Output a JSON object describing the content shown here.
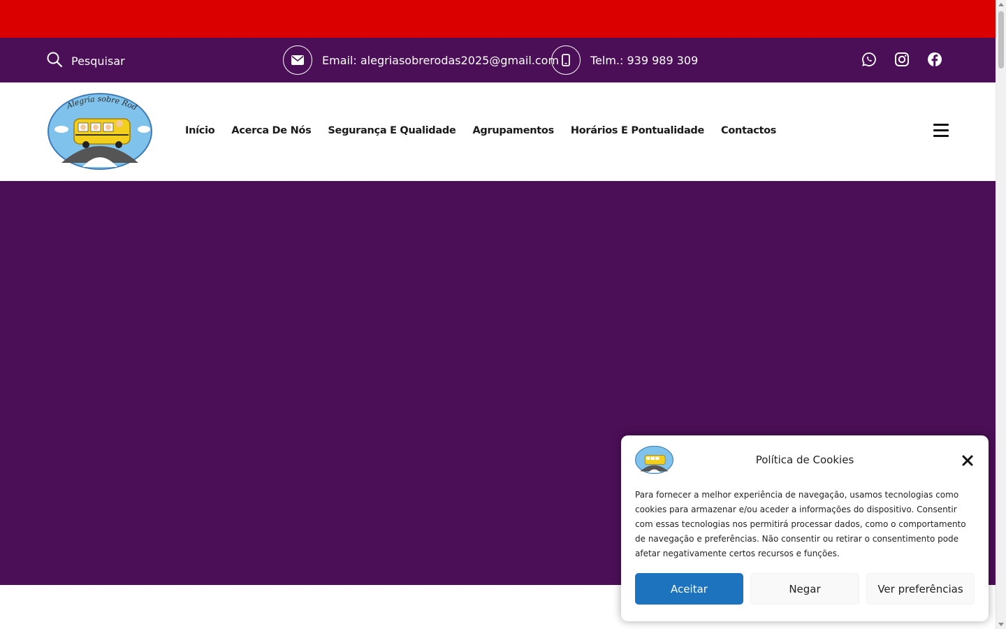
{
  "topbar": {
    "search_label": "Pesquisar",
    "email": "Email: alegriasobrerodas2025@gmail.com",
    "phone": "Telm.: 939 989 309",
    "socials": [
      "whatsapp-icon",
      "instagram-icon",
      "facebook-icon"
    ]
  },
  "header": {
    "logo_text": "Alegria sobre Rodas",
    "nav": [
      "Início",
      "Acerca De Nós",
      "Segurança E Qualidade",
      "Agrupamentos",
      "Horários E Pontualidade",
      "Contactos"
    ]
  },
  "cookie": {
    "title": "Política de Cookies",
    "text": "Para fornecer a melhor experiência de navegação, usamos tecnologias como cookies para armazenar e/ou aceder a informações do dispositivo. Consentir com essas tecnologias nos permitirá processar dados, como o comportamento de navegação e preferências. Não consentir ou retirar o consentimento pode afetar negativamente certos recursos e funções.",
    "accept": "Aceitar",
    "deny": "Negar",
    "preferences": "Ver preferências"
  },
  "colors": {
    "red_bar": "#db0000",
    "purple": "#4b0f57",
    "accept_blue": "#1e73be"
  }
}
